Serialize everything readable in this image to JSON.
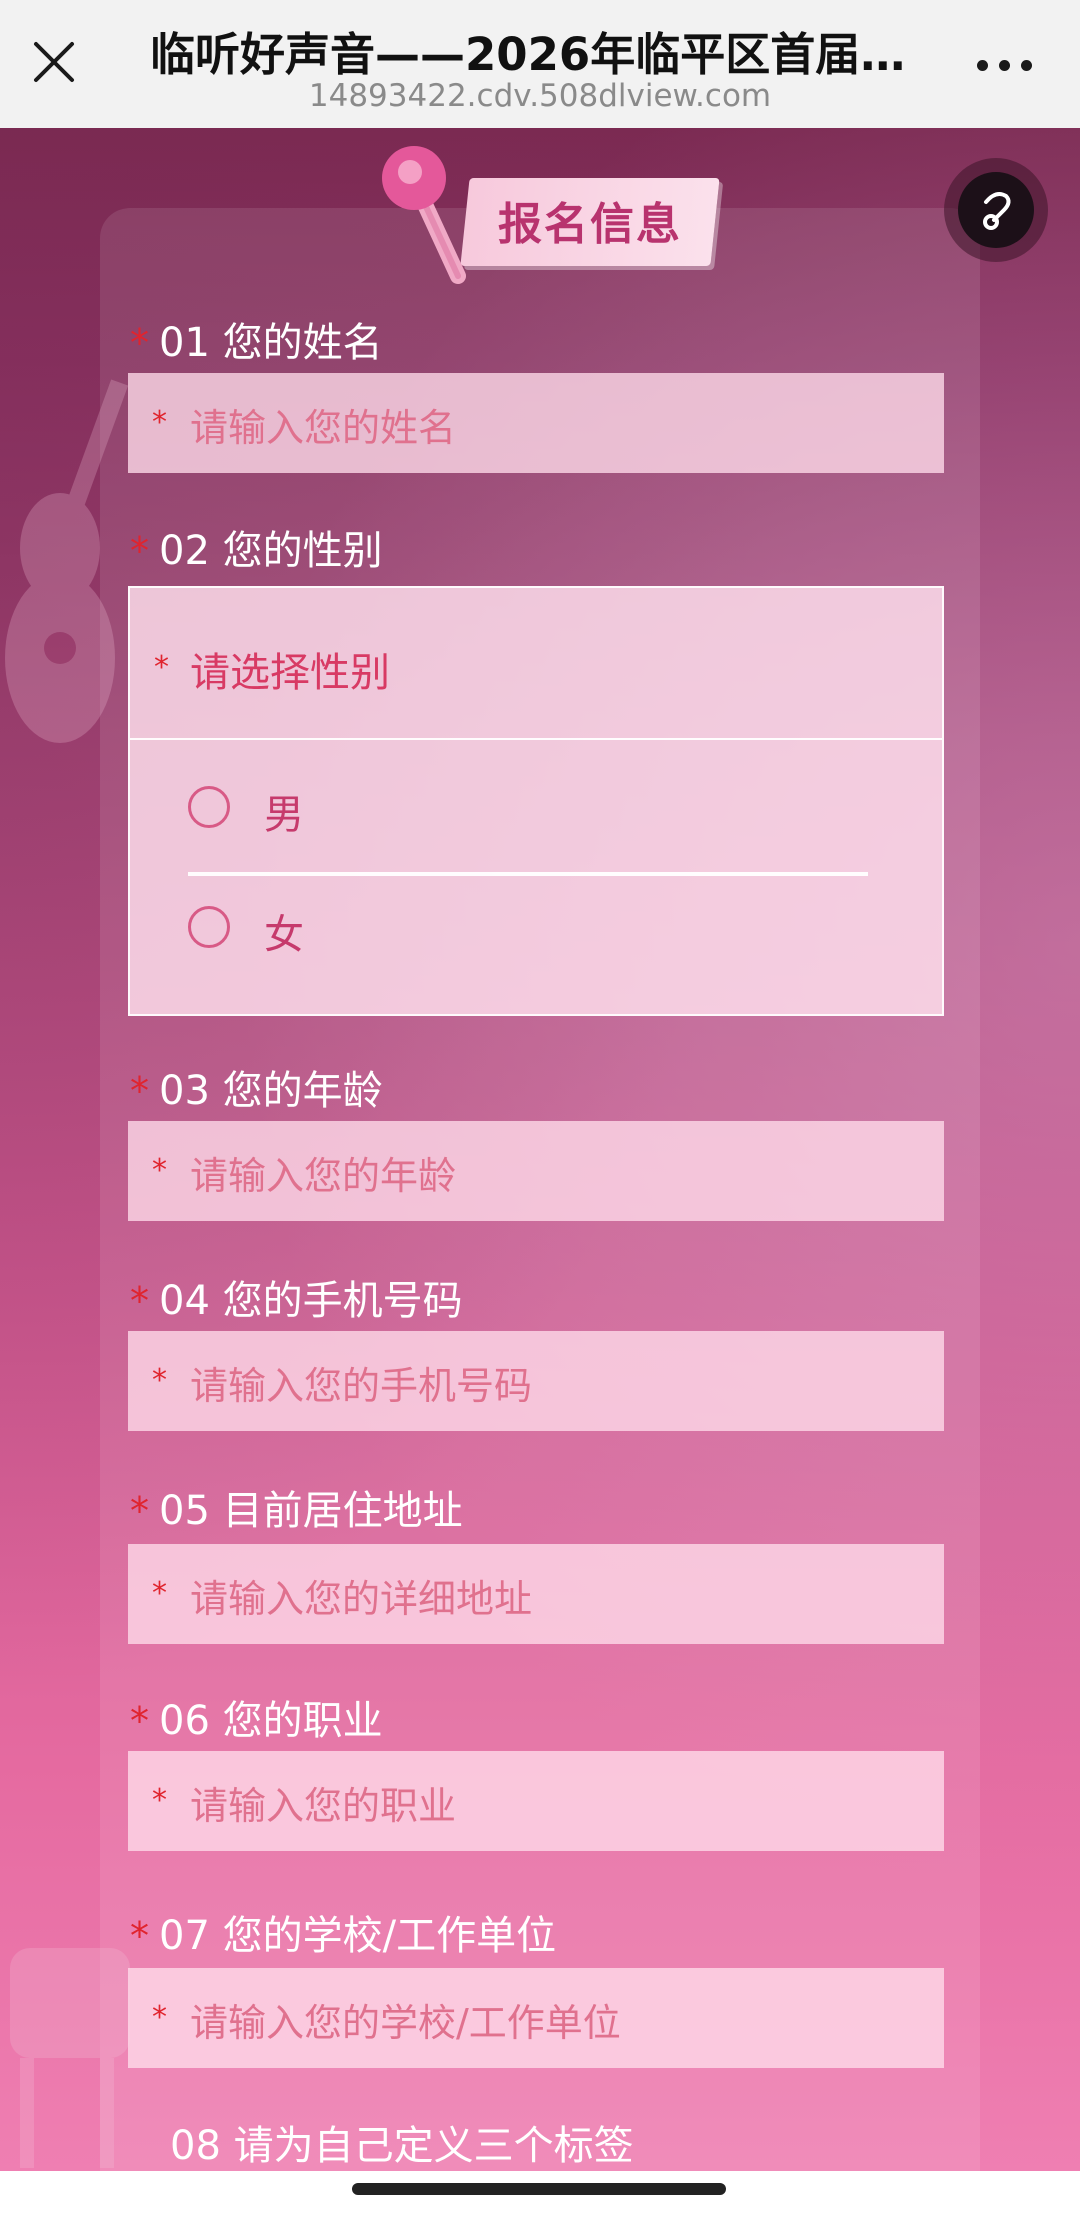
{
  "browser": {
    "title": "临听好声音——2026年临平区首届“...",
    "url": "14893422.cdv.508dlview.com"
  },
  "icons": {
    "close": "close-icon",
    "more": "more-dots-icon",
    "music": "music-toggle-icon",
    "mic": "microphone-icon"
  },
  "header": {
    "section_title": "报名信息"
  },
  "form": {
    "star": "*",
    "q1": {
      "number": "01",
      "label": "01 您的姓名",
      "placeholder": "请输入您的姓名"
    },
    "q2": {
      "label": "02 您的性别",
      "placeholder": "请选择性别",
      "options": [
        "男",
        "女"
      ]
    },
    "q3": {
      "label": "03 您的年龄",
      "placeholder": "请输入您的年龄"
    },
    "q4": {
      "label": "04 您的手机号码",
      "placeholder": "请输入您的手机号码"
    },
    "q5": {
      "label": "05 目前居住地址",
      "placeholder": "请输入您的详细地址"
    },
    "q6": {
      "label": "06 您的职业",
      "placeholder": "请输入您的职业"
    },
    "q7": {
      "label": "07 您的学校/工作单位",
      "placeholder": "请输入您的学校/工作单位"
    },
    "q8": {
      "label": "08 请为自己定义三个标签"
    }
  },
  "colors": {
    "accent": "#e0242e",
    "placeholder": "#e0718e",
    "background_top": "#7b2a52",
    "background_bottom": "#ef7fb2"
  }
}
